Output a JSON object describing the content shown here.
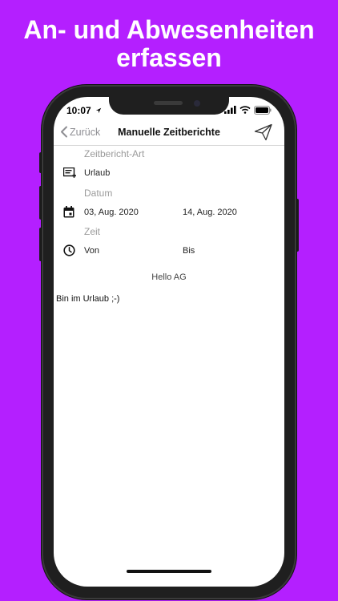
{
  "headline": {
    "line1": "An- und Abwesenheiten",
    "line2": "erfassen"
  },
  "status": {
    "time": "10:07"
  },
  "nav": {
    "back_label": "Zurück",
    "title": "Manuelle Zeitberichte"
  },
  "form": {
    "type_label": "Zeitbericht-Art",
    "type_value": "Urlaub",
    "date_label": "Datum",
    "date_from": "03, Aug. 2020",
    "date_to": "14, Aug. 2020",
    "time_label": "Zeit",
    "time_from": "Von",
    "time_to": "Bis"
  },
  "company": "Hello AG",
  "note": "Bin im Urlaub ;-)",
  "colors": {
    "background": "#b41fff"
  }
}
